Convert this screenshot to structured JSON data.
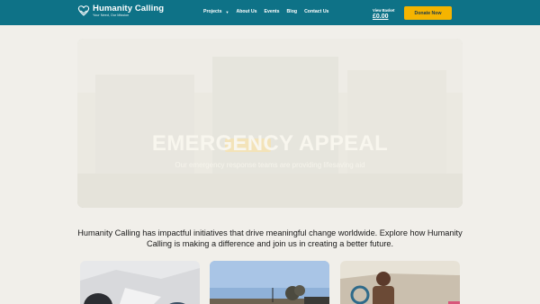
{
  "brand": {
    "name": "Humanity Calling",
    "tagline": "Your Need, Our Mission"
  },
  "nav": {
    "items": [
      {
        "label": "Projects",
        "has_dropdown": true
      },
      {
        "label": "About Us"
      },
      {
        "label": "Events"
      },
      {
        "label": "Blog"
      },
      {
        "label": "Contact Us"
      }
    ]
  },
  "basket": {
    "label": "View Basket",
    "amount": "£0.00"
  },
  "header": {
    "donate_label": "Donate Now"
  },
  "hero": {
    "title": "EMERGENCY APPEAL",
    "subtitle": "Our emergency response teams are providing lifesaving aid"
  },
  "intro": {
    "text": "Humanity Calling has impactful initiatives that drive meaningful change worldwide. Explore how Humanity Calling is making a difference and join us in creating a better future."
  },
  "colors": {
    "header_bg": "#0e7287",
    "accent": "#f5b400",
    "page_bg": "#f1efea"
  },
  "icons": {
    "logo": "heart-hands-icon",
    "dropdown": "chevron-down-icon"
  }
}
